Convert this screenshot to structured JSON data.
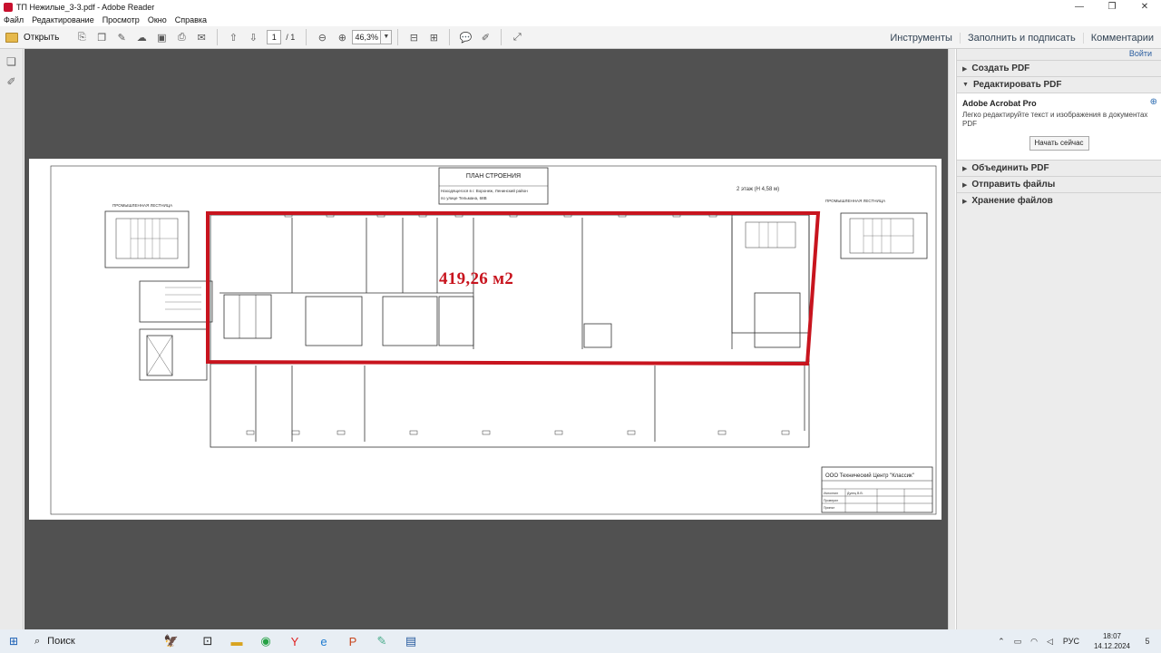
{
  "window": {
    "title": "ТП Нежилые_3-3.pdf - Adobe Reader",
    "minimize": "—",
    "maximize": "❐",
    "close": "✕"
  },
  "menu": [
    "Файл",
    "Редактирование",
    "Просмотр",
    "Окно",
    "Справка"
  ],
  "toolbar": {
    "open_label": "Открыть",
    "page_current": "1",
    "page_total": "/ 1",
    "zoom": "46,3%",
    "tools": "Инструменты",
    "fill_sign": "Заполнить и подписать",
    "comments": "Комментарии"
  },
  "drawing": {
    "plan_title": "ПЛАН СТРОЕНИЯ",
    "address_line1": "Находящегося в г. Воронеж, Ленинский район",
    "address_line2": "по улице Тельмана, 68В",
    "floor_label": "2 этаж (H 4,58 м)",
    "stair_left": "ПРОМЫШЛЕННАЯ ЛЕСТНИЦА",
    "stair_right": "ПРОМЫШЛЕННАЯ ЛЕСТНИЦА",
    "company": "ООО Технический Центр \"Классик\"",
    "highlight_area": "419,26 м2",
    "stamp_rows": [
      "Исполнил",
      "Проверил",
      "Принял"
    ],
    "stamp_name": "Дунец В.В."
  },
  "right_panel": {
    "login": "Войти",
    "sections": [
      {
        "label": "Создать PDF",
        "expanded": false
      },
      {
        "label": "Редактировать PDF",
        "expanded": true
      },
      {
        "label": "Объединить PDF",
        "expanded": false
      },
      {
        "label": "Отправить файлы",
        "expanded": false
      },
      {
        "label": "Хранение файлов",
        "expanded": false
      }
    ],
    "product": "Adobe Acrobat Pro",
    "product_desc": "Легко редактируйте текст и изображения в документах PDF",
    "start_button": "Начать сейчас"
  },
  "taskbar": {
    "search": "Поиск",
    "lang": "РУС",
    "time": "18:07",
    "date": "14.12.2024",
    "notifications": "5"
  },
  "colors": {
    "highlight_red": "#c8141e",
    "document_bg": "#515151",
    "panel_bg": "#ececec"
  }
}
